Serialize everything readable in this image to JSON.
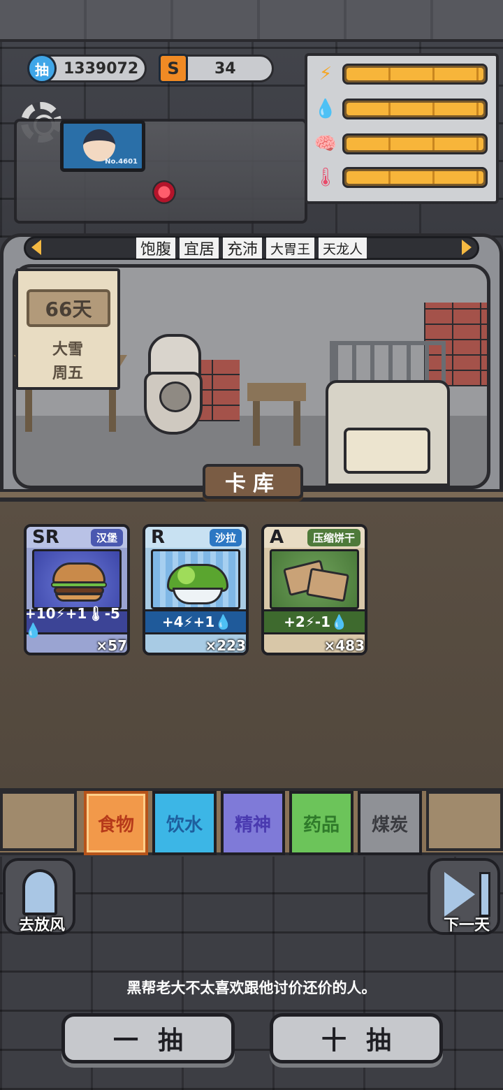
{
  "currency": {
    "draw_tickets": "1339072",
    "coins": "34",
    "draw_icon_char": "抽",
    "coin_icon_char": "S"
  },
  "status": [
    {
      "name": "energy",
      "icon": "lightning-icon",
      "level": 1.0
    },
    {
      "name": "water",
      "icon": "water-drop-icon",
      "level": 1.0
    },
    {
      "name": "mind",
      "icon": "brain-icon",
      "level": 1.0
    },
    {
      "name": "temperature",
      "icon": "thermometer-icon",
      "level": 1.0
    }
  ],
  "monitor": {
    "id_label": "No.4601"
  },
  "achievement_tabs": [
    "饱腹",
    "宜居",
    "充沛",
    "大胃王",
    "天龙人"
  ],
  "calendar": {
    "day": "66天",
    "weather": "大雪",
    "weekday": "周五"
  },
  "card_library_button": "卡库",
  "cards": [
    {
      "rarity": "SR",
      "name": "汉堡",
      "effect": "+10⚡+1🌡-5💧",
      "count": "×57"
    },
    {
      "rarity": "R",
      "name": "沙拉",
      "effect": "+4⚡+1💧",
      "count": "×223"
    },
    {
      "rarity": "A",
      "name": "压缩饼干",
      "effect": "+2⚡-1💧",
      "count": "×483"
    }
  ],
  "categories": {
    "selected": "食物",
    "items": [
      "食物",
      "饮水",
      "精神",
      "药品",
      "煤炭"
    ]
  },
  "side_buttons": {
    "left_label": "去放风",
    "right_label": "下一天"
  },
  "tip": "黑帮老大不太喜欢跟他讨价还价的人。",
  "draw_buttons": {
    "single": "一抽",
    "ten": "十抽"
  },
  "colors": {
    "accent_orange": "#f5b942",
    "panel_gray": "#cfd1d4",
    "wood": "#7a5c44"
  }
}
